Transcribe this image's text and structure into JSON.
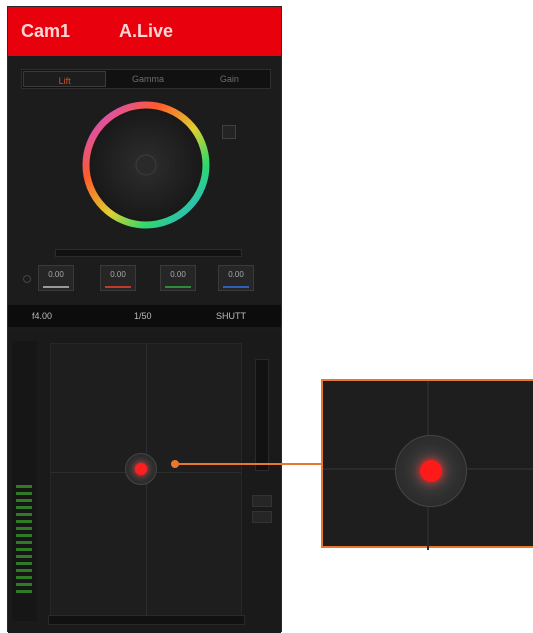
{
  "header": {
    "camera_label": "Cam1",
    "live_label": "A.Live",
    "bar_color": "#e8000c"
  },
  "tabs": [
    {
      "label": "Lift",
      "active": true
    },
    {
      "label": "Gamma",
      "active": false
    },
    {
      "label": "Gain",
      "active": false
    }
  ],
  "color_wheel": {
    "icon": "color-wheel-icon"
  },
  "params": [
    {
      "value": "0.00",
      "underline_color": "#9a9a9a"
    },
    {
      "value": "0.00",
      "underline_color": "#c0392b"
    },
    {
      "value": "0.00",
      "underline_color": "#2e8b3a"
    },
    {
      "value": "0.00",
      "underline_color": "#2f5fb8"
    }
  ],
  "info_bar": {
    "left": "f4.00",
    "center": "1/50",
    "right": "SHUTT"
  },
  "focus_control": {
    "indicator_color": "#ff1f1f"
  },
  "callout": {
    "color": "#e8782e"
  }
}
